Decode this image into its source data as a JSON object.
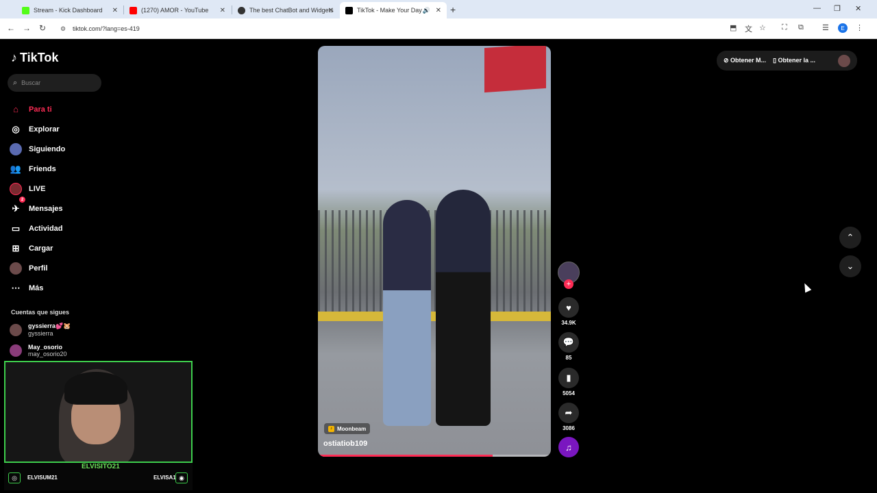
{
  "browser": {
    "tabs": [
      {
        "title": "Stream - Kick Dashboard",
        "icon": "kick-icon",
        "color": "#53fc18"
      },
      {
        "title": "(1270) AMOR - YouTube",
        "icon": "youtube-icon",
        "color": "#ff0000"
      },
      {
        "title": "The best ChatBot and Widgets",
        "icon": "github-icon",
        "color": "#333333"
      },
      {
        "title": "TikTok - Make Your Day",
        "icon": "tiktok-icon",
        "color": "#000000"
      }
    ],
    "url": "tiktok.com/?lang=es-419",
    "profile_initial": "E"
  },
  "sidebar": {
    "logo": "TikTok",
    "search_placeholder": "Buscar",
    "items": [
      {
        "label": "Para ti",
        "icon": "home-icon"
      },
      {
        "label": "Explorar",
        "icon": "compass-icon"
      },
      {
        "label": "Siguiendo",
        "icon": "following-avatar-icon"
      },
      {
        "label": "Friends",
        "icon": "friends-icon"
      },
      {
        "label": "LIVE",
        "icon": "live-icon"
      },
      {
        "label": "Mensajes",
        "icon": "messages-icon",
        "badge": "2"
      },
      {
        "label": "Actividad",
        "icon": "activity-icon"
      },
      {
        "label": "Cargar",
        "icon": "upload-icon"
      },
      {
        "label": "Perfil",
        "icon": "profile-avatar-icon"
      },
      {
        "label": "Más",
        "icon": "more-icon"
      }
    ],
    "following_title": "Cuentas que sigues",
    "accounts": [
      {
        "display": "gyssierra💕🐹",
        "handle": "gyssierra"
      },
      {
        "display": "May_osorio",
        "handle": "may_osorio20"
      }
    ]
  },
  "stream_overlay": {
    "name": "ELVISITO21",
    "left_user": "ELVISUM21",
    "right_user": "ELVISA1"
  },
  "video": {
    "music": "Moonbeam",
    "author": "ostiatiob109",
    "progress": 0.75
  },
  "actions": {
    "likes": "34.9K",
    "comments": "85",
    "saves": "5054",
    "shares": "3086"
  },
  "topright": {
    "btn1": "Obtener M...",
    "btn2": "Obtener la ..."
  },
  "colors": {
    "accent": "#fe2c55",
    "stream_green": "#3ecf4c"
  }
}
